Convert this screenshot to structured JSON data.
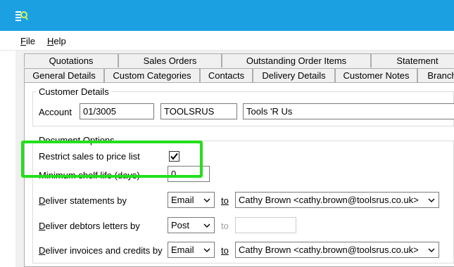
{
  "menu": {
    "file": {
      "accel": "F",
      "rest": "ile"
    },
    "help": {
      "accel": "H",
      "rest": "elp"
    }
  },
  "tabs_top": [
    "Quotations",
    "Sales Orders",
    "Outstanding Order Items",
    "Statement"
  ],
  "tabs_bottom": [
    "General Details",
    "Custom Categories",
    "Contacts",
    "Delivery Details",
    "Customer Notes",
    "Branch"
  ],
  "customer_details": {
    "title": "Customer Details",
    "account_label": "Account",
    "account_code": "01/3005",
    "short_name": "TOOLSRUS",
    "name": "Tools 'R Us"
  },
  "document_options": {
    "title": "Document Options",
    "restrict_label": "Restrict sales to price list",
    "restrict_checked": true,
    "shelf_life_label": "Minimum shelf life (days)",
    "shelf_life_value": "0",
    "to_label": "to",
    "statements": {
      "accel": "D",
      "rest": "eliver statements by",
      "method": "Email",
      "recipient": "Cathy Brown <cathy.brown@toolsrus.co.uk>"
    },
    "debtors": {
      "accel": "D",
      "rest": "eliver debtors letters by",
      "method": "Post",
      "recipient": ""
    },
    "invoices": {
      "accel": "D",
      "rest": "eliver invoices and credits by",
      "method": "Email",
      "recipient": "Cathy Brown <cathy.brown@toolsrus.co.uk>"
    }
  },
  "colors": {
    "highlight": "#22e01b",
    "titlebar": "#1ba1e2"
  }
}
